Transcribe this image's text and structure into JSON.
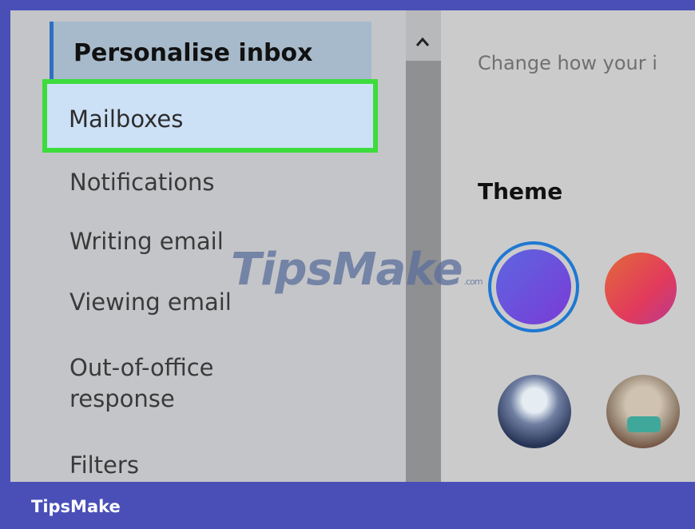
{
  "sidebar": {
    "header": "Personalise inbox",
    "items": [
      {
        "label": "Mailboxes"
      },
      {
        "label": "Notifications"
      },
      {
        "label": "Writing email"
      },
      {
        "label": "Viewing email"
      },
      {
        "label": "Out-of-office\nresponse"
      },
      {
        "label": "Filters"
      }
    ]
  },
  "scrollbar": {
    "up_icon": "chevron-up-icon"
  },
  "main": {
    "hint": "Change how your i",
    "theme_title": "Theme",
    "themes": [
      {
        "name": "blue-purple",
        "selected": true,
        "color": "#6a56df"
      },
      {
        "name": "orange-red",
        "selected": false,
        "color": "#e2503f"
      },
      {
        "name": "mountain",
        "selected": false,
        "color": "#3a4a6e"
      },
      {
        "name": "camper",
        "selected": false,
        "color": "#9a8a77"
      }
    ]
  },
  "watermark": {
    "text": "TipsMake",
    "suffix": ".com"
  },
  "footer": {
    "brand": "TipsMake"
  },
  "colors": {
    "highlight_border": "#3ddc3d",
    "accent": "#2e6fc4",
    "brand_bar": "#4a4fb8"
  }
}
